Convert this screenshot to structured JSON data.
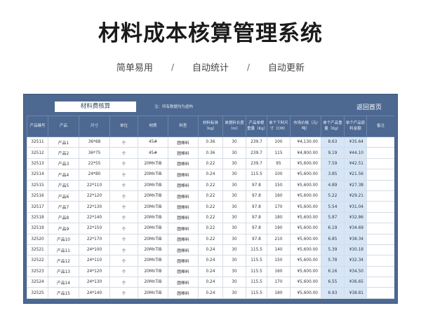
{
  "page": {
    "title": "材料成本核算管理系统",
    "subtitle": [
      "简单易用",
      "自动统计",
      "自动更新"
    ],
    "separator": "/"
  },
  "sheet": {
    "title": "材料费核算",
    "note": "注：所有数据均为虚构",
    "back_label": "返回首页",
    "columns": [
      "产品编号",
      "产品",
      "尺寸",
      "单位",
      "材质",
      "料型",
      "材料标准（kg）",
      "单据料长度（m）",
      "产品单根重量（Kg）",
      "单个下料尺寸（CM）",
      "市场价格（元/吨）",
      "单个产品重量（Kg）",
      "单个产品原料金额",
      "备注"
    ],
    "rows": [
      [
        "32511",
        "产品1",
        "36*68",
        "个",
        "45#",
        "圆棒料",
        "0.36",
        "30",
        "239.7",
        "100",
        "¥4,130.00",
        "8.63",
        "¥35.64",
        ""
      ],
      [
        "32512",
        "产品2",
        "36*75",
        "个",
        "45#",
        "圆棒料",
        "0.36",
        "30",
        "239.7",
        "115",
        "¥4,800.00",
        "9.19",
        "¥44.10",
        ""
      ],
      [
        "32513",
        "产品3",
        "22*55",
        "个",
        "20MnTiB",
        "圆棒料",
        "0.22",
        "30",
        "239.7",
        "95",
        "¥5,600.00",
        "7.59",
        "¥42.51",
        ""
      ],
      [
        "32514",
        "产品4",
        "24*80",
        "个",
        "20MnTiB",
        "圆棒料",
        "0.24",
        "30",
        "115.5",
        "100",
        "¥5,600.00",
        "3.85",
        "¥21.56",
        ""
      ],
      [
        "32515",
        "产品5",
        "22*110",
        "个",
        "20MnTiB",
        "圆棒料",
        "0.22",
        "30",
        "97.8",
        "150",
        "¥5,600.00",
        "4.89",
        "¥27.38",
        ""
      ],
      [
        "32516",
        "产品6",
        "22*120",
        "个",
        "20MnTiB",
        "圆棒料",
        "0.22",
        "30",
        "97.8",
        "160",
        "¥5,600.00",
        "5.22",
        "¥29.21",
        ""
      ],
      [
        "32517",
        "产品7",
        "22*130",
        "个",
        "20MnTiB",
        "圆棒料",
        "0.22",
        "30",
        "97.8",
        "170",
        "¥5,600.00",
        "5.54",
        "¥31.04",
        ""
      ],
      [
        "32518",
        "产品8",
        "22*140",
        "个",
        "20MnTiB",
        "圆棒料",
        "0.22",
        "30",
        "97.8",
        "180",
        "¥5,600.00",
        "5.87",
        "¥32.86",
        ""
      ],
      [
        "32519",
        "产品9",
        "22*150",
        "个",
        "20MnTiB",
        "圆棒料",
        "0.22",
        "30",
        "97.8",
        "190",
        "¥5,600.00",
        "6.19",
        "¥34.69",
        ""
      ],
      [
        "32520",
        "产品10",
        "22*170",
        "个",
        "20MnTiB",
        "圆棒料",
        "0.22",
        "30",
        "97.8",
        "210",
        "¥5,600.00",
        "6.85",
        "¥38.34",
        ""
      ],
      [
        "32521",
        "产品11",
        "24*100",
        "个",
        "20MnTiB",
        "圆棒料",
        "0.24",
        "30",
        "115.5",
        "140",
        "¥5,600.00",
        "5.39",
        "¥30.18",
        ""
      ],
      [
        "32522",
        "产品12",
        "24*110",
        "个",
        "20MnTiB",
        "圆棒料",
        "0.24",
        "30",
        "115.5",
        "150",
        "¥5,600.00",
        "5.78",
        "¥32.34",
        ""
      ],
      [
        "32523",
        "产品13",
        "24*120",
        "个",
        "20MnTiB",
        "圆棒料",
        "0.24",
        "30",
        "115.5",
        "160",
        "¥5,600.00",
        "6.16",
        "¥34.50",
        ""
      ],
      [
        "32524",
        "产品14",
        "24*130",
        "个",
        "20MnTiB",
        "圆棒料",
        "0.24",
        "30",
        "115.5",
        "170",
        "¥5,600.00",
        "6.55",
        "¥36.65",
        ""
      ],
      [
        "32525",
        "产品15",
        "24*140",
        "个",
        "20MnTiB",
        "圆棒料",
        "0.24",
        "30",
        "115.5",
        "180",
        "¥5,600.00",
        "6.93",
        "¥38.81",
        ""
      ]
    ],
    "highlight_columns": [
      11,
      12
    ]
  }
}
